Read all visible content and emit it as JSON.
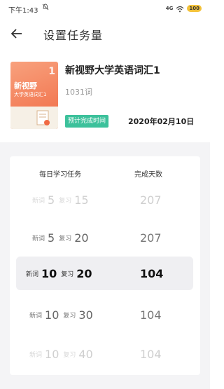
{
  "status_bar": {
    "time": "下午1:43",
    "mute_icon": "bell-off-icon",
    "signal": "4G",
    "wifi_icon": "wifi-icon",
    "battery": "100"
  },
  "header": {
    "back_icon": "arrow-left-icon",
    "title": "设置任务量"
  },
  "book": {
    "cover_title": "新视野",
    "cover_subtitle": "大学英语词汇1",
    "cover_number": "1",
    "name": "新视野大学英语词汇1",
    "word_count": "1031词",
    "badge_label": "预计完成时间",
    "finish_date": "2020年02月10日"
  },
  "picker": {
    "col_task_label": "每日学习任务",
    "col_days_label": "完成天数",
    "rows": [
      {
        "new_label": "新词",
        "new": "5",
        "review_label": "复习",
        "review": "15",
        "days": "207"
      },
      {
        "new_label": "新词",
        "new": "5",
        "review_label": "复习",
        "review": "20",
        "days": "207"
      },
      {
        "new_label": "新词",
        "new": "10",
        "review_label": "复习",
        "review": "20",
        "days": "104"
      },
      {
        "new_label": "新词",
        "new": "10",
        "review_label": "复习",
        "review": "30",
        "days": "104"
      },
      {
        "new_label": "新词",
        "new": "10",
        "review_label": "复习",
        "review": "40",
        "days": "104"
      }
    ]
  },
  "colors": {
    "accent": "#3cc19b",
    "cover": "#f06a44",
    "battery": "#f3c23a"
  }
}
